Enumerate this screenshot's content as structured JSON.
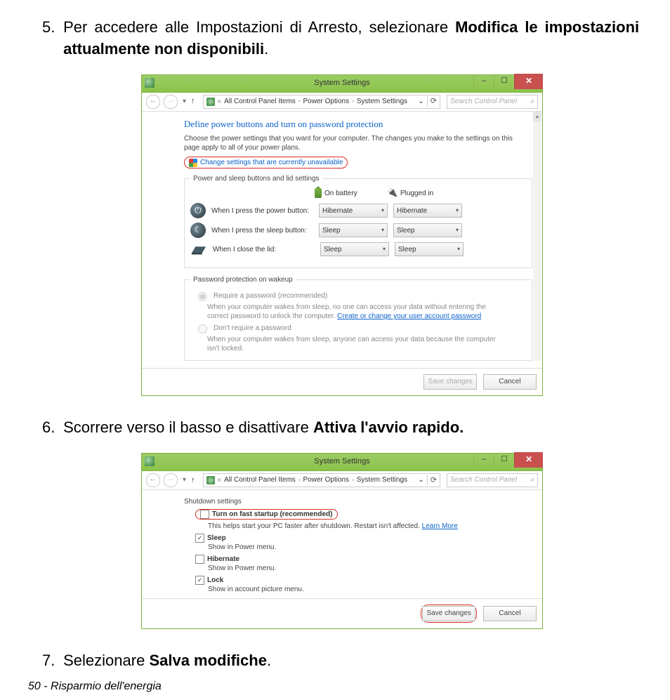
{
  "steps": {
    "s5": {
      "num": "5.",
      "part1": "Per accedere alle Impostazioni di Arresto, selezionare ",
      "bold": "Modifica le impostazioni attualmente non disponibili",
      "part2": "."
    },
    "s6": {
      "num": "6.",
      "part1": "Scorrere verso il basso e disattivare ",
      "bold": "Attiva l'avvio rapido."
    },
    "s7": {
      "num": "7.",
      "part1": "Selezionare ",
      "bold": "Salva modifiche",
      "part2": "."
    }
  },
  "footer": "50 - Risparmio dell'energia",
  "window": {
    "title": "System Settings",
    "min": "–",
    "max": "☐",
    "close": "✕",
    "nav": {
      "back": "←",
      "fwd": "→",
      "drop": "▾",
      "up": "↑",
      "laquo": "«",
      "c1": "All Control Panel Items",
      "c2": "Power Options",
      "c3": "System Settings",
      "sep": "›",
      "drop2": "⌄",
      "refresh": "⟳"
    },
    "search": {
      "placeholder": "Search Control Panel",
      "mag": "🔍"
    }
  },
  "p1": {
    "heading": "Define power buttons and turn on password protection",
    "sub": "Choose the power settings that you want for your computer. The changes you make to the settings on this page apply to all of your power plans.",
    "change": "Change settings that are currently unavailable",
    "legend1": "Power and sleep buttons and lid settings",
    "on_battery": "On battery",
    "plugged_in": "Plugged in",
    "row1": "When I press the power button:",
    "row2": "When I press the sleep button:",
    "row3": "When I close the lid:",
    "dd1a": "Hibernate",
    "dd1b": "Hibernate",
    "dd2a": "Sleep",
    "dd2b": "Sleep",
    "dd3a": "Sleep",
    "dd3b": "Sleep",
    "legend2": "Password protection on wakeup",
    "r1": "Require a password (recommended)",
    "r1d_a": "When your computer wakes from sleep, no one can access your data without entering the correct password to unlock the computer. ",
    "r1_link": "Create or change your user account password",
    "r2": "Don't require a password",
    "r2d": "When your computer wakes from sleep, anyone can access your data because the computer isn't locked.",
    "save": "Save changes",
    "cancel": "Cancel"
  },
  "p2": {
    "legend": "Shutdown settings",
    "o1": "Turn on fast startup (recommended)",
    "o1d_a": "This helps start your PC faster after shutdown. Restart isn't affected. ",
    "o1_link": "Learn More",
    "o2": "Sleep",
    "o2d": "Show in Power menu.",
    "o3": "Hibernate",
    "o3d": "Show in Power menu.",
    "o4": "Lock",
    "o4d": "Show in account picture menu.",
    "save": "Save changes",
    "cancel": "Cancel"
  }
}
